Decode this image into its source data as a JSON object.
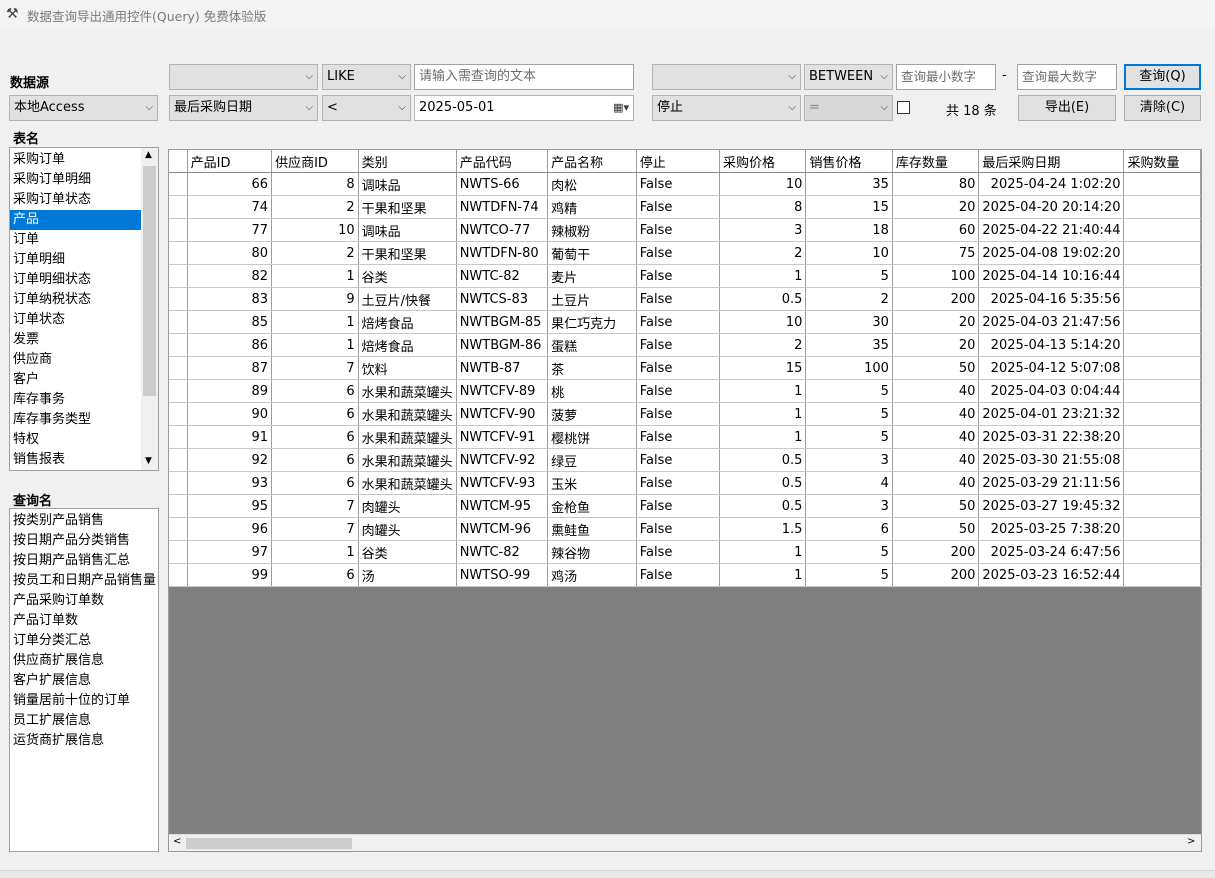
{
  "window": {
    "title": "数据查询导出通用控件(Query) 免费体验版",
    "icon": "tools-icon"
  },
  "datasource": {
    "label": "数据源",
    "value": "本地Access"
  },
  "filters": {
    "text_field": "",
    "text_operator": "LIKE",
    "text_placeholder": "请输入需查询的文本",
    "date_field": "最后采购日期",
    "date_operator": "<",
    "date_value": "2025-05-01",
    "num_field": "",
    "num_operator": "BETWEEN",
    "num_min_placeholder": "查询最小数字",
    "num_dash": "-",
    "num_max_placeholder": "查询最大数字",
    "bool_field": "停止",
    "bool_operator": "=",
    "bool_checked": false,
    "count_text": "共 18 条"
  },
  "buttons": {
    "query": "查询(Q)",
    "export": "导出(E)",
    "clear": "清除(C)"
  },
  "tables": {
    "label": "表名",
    "items": [
      "采购订单",
      "采购订单明细",
      "采购订单状态",
      "产品",
      "订单",
      "订单明细",
      "订单明细状态",
      "订单纳税状态",
      "订单状态",
      "发票",
      "供应商",
      "客户",
      "库存事务",
      "库存事务类型",
      "特权",
      "销售报表"
    ],
    "selected": "产品"
  },
  "queries": {
    "label": "查询名",
    "items": [
      "按类别产品销售",
      "按日期产品分类销售",
      "按日期产品销售汇总",
      "按员工和日期产品销售量",
      "产品采购订单数",
      "产品订单数",
      "订单分类汇总",
      "供应商扩展信息",
      "客户扩展信息",
      "销量居前十位的订单",
      "员工扩展信息",
      "运货商扩展信息"
    ]
  },
  "grid": {
    "columns": [
      "产品ID",
      "供应商ID",
      "类别",
      "产品代码",
      "产品名称",
      "停止",
      "采购价格",
      "销售价格",
      "库存数量",
      "最后采购日期",
      "采购数量"
    ],
    "rows": [
      [
        "66",
        "8",
        "调味品",
        "NWTS-66",
        "肉松",
        "False",
        "10",
        "35",
        "80",
        "2025-04-24 1:02:20",
        ""
      ],
      [
        "74",
        "2",
        "干果和坚果",
        "NWTDFN-74",
        "鸡精",
        "False",
        "8",
        "15",
        "20",
        "2025-04-20 20:14:20",
        ""
      ],
      [
        "77",
        "10",
        "调味品",
        "NWTCO-77",
        "辣椒粉",
        "False",
        "3",
        "18",
        "60",
        "2025-04-22 21:40:44",
        ""
      ],
      [
        "80",
        "2",
        "干果和坚果",
        "NWTDFN-80",
        "葡萄干",
        "False",
        "2",
        "10",
        "75",
        "2025-04-08 19:02:20",
        ""
      ],
      [
        "82",
        "1",
        "谷类",
        "NWTC-82",
        "麦片",
        "False",
        "1",
        "5",
        "100",
        "2025-04-14 10:16:44",
        ""
      ],
      [
        "83",
        "9",
        "土豆片/快餐",
        "NWTCS-83",
        "土豆片",
        "False",
        "0.5",
        "2",
        "200",
        "2025-04-16 5:35:56",
        ""
      ],
      [
        "85",
        "1",
        "焙烤食品",
        "NWTBGM-85",
        "果仁巧克力",
        "False",
        "10",
        "30",
        "20",
        "2025-04-03 21:47:56",
        ""
      ],
      [
        "86",
        "1",
        "焙烤食品",
        "NWTBGM-86",
        "蛋糕",
        "False",
        "2",
        "35",
        "20",
        "2025-04-13 5:14:20",
        ""
      ],
      [
        "87",
        "7",
        "饮料",
        "NWTB-87",
        "茶",
        "False",
        "15",
        "100",
        "50",
        "2025-04-12 5:07:08",
        ""
      ],
      [
        "89",
        "6",
        "水果和蔬菜罐头",
        "NWTCFV-89",
        "桃",
        "False",
        "1",
        "5",
        "40",
        "2025-04-03 0:04:44",
        ""
      ],
      [
        "90",
        "6",
        "水果和蔬菜罐头",
        "NWTCFV-90",
        "菠萝",
        "False",
        "1",
        "5",
        "40",
        "2025-04-01 23:21:32",
        ""
      ],
      [
        "91",
        "6",
        "水果和蔬菜罐头",
        "NWTCFV-91",
        "樱桃饼",
        "False",
        "1",
        "5",
        "40",
        "2025-03-31 22:38:20",
        ""
      ],
      [
        "92",
        "6",
        "水果和蔬菜罐头",
        "NWTCFV-92",
        "绿豆",
        "False",
        "0.5",
        "3",
        "40",
        "2025-03-30 21:55:08",
        ""
      ],
      [
        "93",
        "6",
        "水果和蔬菜罐头",
        "NWTCFV-93",
        "玉米",
        "False",
        "0.5",
        "4",
        "40",
        "2025-03-29 21:11:56",
        ""
      ],
      [
        "95",
        "7",
        "肉罐头",
        "NWTCM-95",
        "金枪鱼",
        "False",
        "0.5",
        "3",
        "50",
        "2025-03-27 19:45:32",
        ""
      ],
      [
        "96",
        "7",
        "肉罐头",
        "NWTCM-96",
        "熏鲑鱼",
        "False",
        "1.5",
        "6",
        "50",
        "2025-03-25 7:38:20",
        ""
      ],
      [
        "97",
        "1",
        "谷类",
        "NWTC-82",
        "辣谷物",
        "False",
        "1",
        "5",
        "200",
        "2025-03-24 6:47:56",
        ""
      ],
      [
        "99",
        "6",
        "汤",
        "NWTSO-99",
        "鸡汤",
        "False",
        "1",
        "5",
        "200",
        "2025-03-23 16:52:44",
        ""
      ]
    ]
  },
  "colors": {
    "selection": "#0078d7",
    "grid_empty": "#808080"
  }
}
